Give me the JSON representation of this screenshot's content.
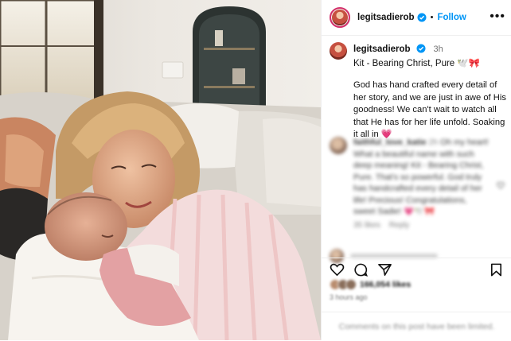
{
  "post": {
    "username": "legitsadierob",
    "follow_label": "Follow",
    "more_label": "•••"
  },
  "caption": {
    "username": "legitsadierob",
    "time": "3h",
    "title": "Kit - Bearing Christ, Pure 🕊️🎀",
    "body": "God has hand crafted every detail of her story, and we are just in awe of His goodness! We can't wait to watch all that He has for her life unfold. Soaking it all in 💗"
  },
  "comment": {
    "username": "faithful_love_katie",
    "time": "2h",
    "text": "Oh my heart! What a beautiful name with such deep meaning! Kit - Bearing Christ, Pure. That's so powerful. God truly has handcrafted every detail of her life! Precious! Congratulations, sweet Sadie! 💗🕊️🎀",
    "likes": "35 likes",
    "reply": "Reply"
  },
  "stats": {
    "likes": "166,054 likes",
    "ago": "3 hours ago"
  },
  "footer": {
    "text": "Comments on this post have been limited."
  },
  "icons": {
    "like": "heart-icon",
    "comment": "comment-icon",
    "share": "share-icon",
    "save": "bookmark-icon",
    "verified": "verified-badge-icon"
  },
  "colors": {
    "link": "#0095f6",
    "verified": "#0095f6",
    "story_ring": "#d3306b"
  }
}
